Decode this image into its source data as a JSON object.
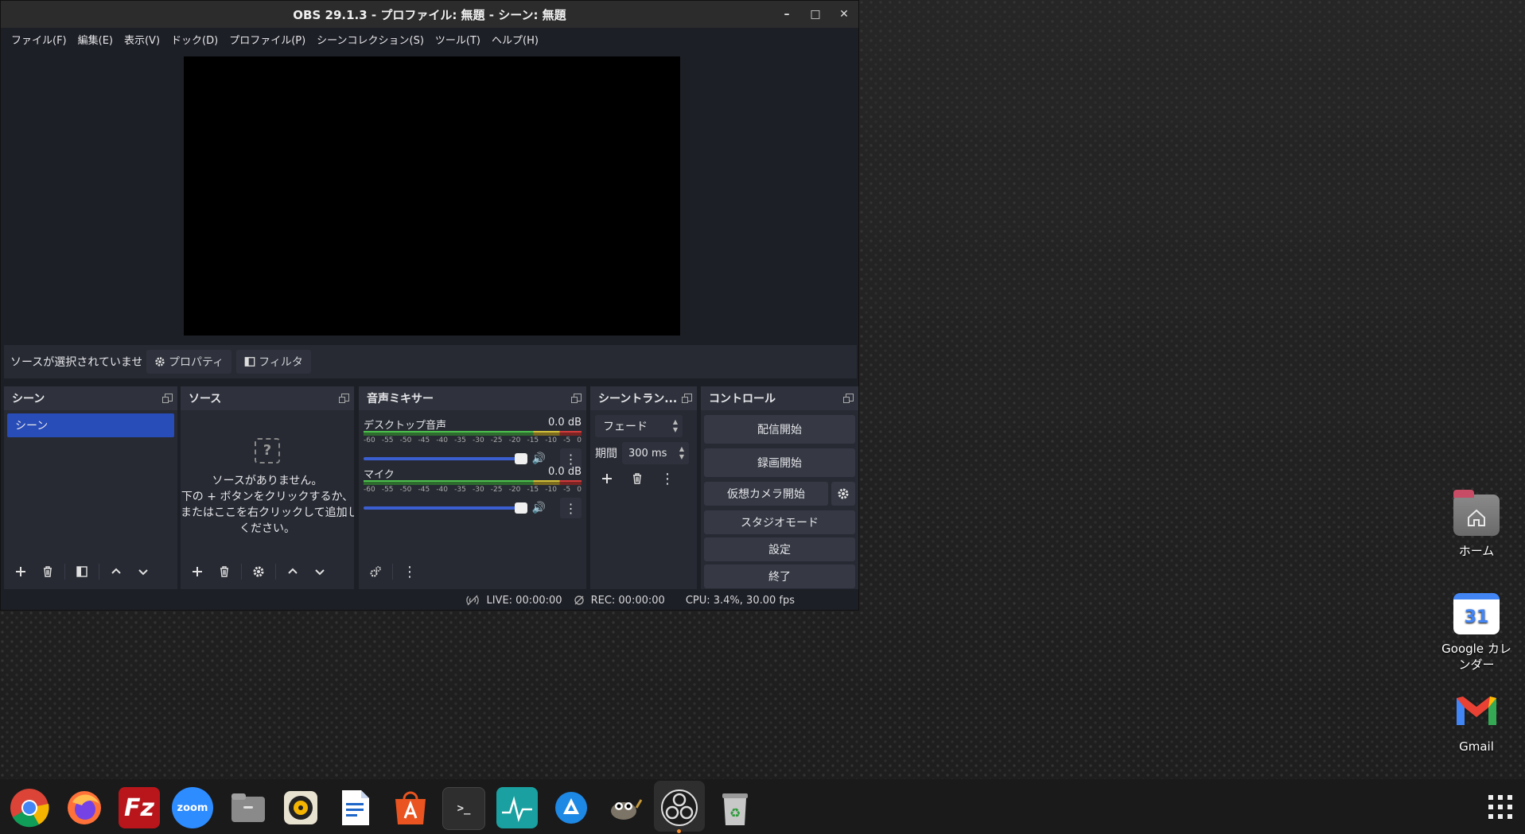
{
  "window": {
    "title": "OBS 29.1.3 - プロファイル: 無題 - シーン: 無題",
    "minimize_glyph": "–",
    "maximize_glyph": "□",
    "close_glyph": "✕"
  },
  "menu": [
    "ファイル(F)",
    "編集(E)",
    "表示(V)",
    "ドック(D)",
    "プロファイル(P)",
    "シーンコレクション(S)",
    "ツール(T)",
    "ヘルプ(H)"
  ],
  "source_toolbar": {
    "no_source": "ソースが選択されていません",
    "properties": "プロパティ",
    "filters": "フィルタ"
  },
  "docks": {
    "scenes": {
      "title": "シーン",
      "items": [
        "シーン"
      ]
    },
    "sources": {
      "title": "ソース",
      "empty_line1": "ソースがありません。",
      "empty_line2": "下の + ボタンをクリックするか、",
      "empty_line3": "またはここを右クリックして追加して",
      "empty_line4": "ください。"
    },
    "mixer": {
      "title": "音声ミキサー",
      "channels": [
        {
          "name": "デスクトップ音声",
          "db": "0.0 dB"
        },
        {
          "name": "マイク",
          "db": "0.0 dB"
        }
      ],
      "ticks": [
        "-60",
        "-55",
        "-50",
        "-45",
        "-40",
        "-35",
        "-30",
        "-25",
        "-20",
        "-15",
        "-10",
        "-5",
        "0"
      ]
    },
    "transitions": {
      "title": "シーントラン...",
      "selected": "フェード",
      "duration_label": "期間",
      "duration_value": "300 ms"
    },
    "controls": {
      "title": "コントロール",
      "start_streaming": "配信開始",
      "start_recording": "録画開始",
      "virtual_camera": "仮想カメラ開始",
      "studio_mode": "スタジオモード",
      "settings": "設定",
      "exit": "終了"
    }
  },
  "status": {
    "live": "LIVE: 00:00:00",
    "rec": "REC: 00:00:00",
    "cpu": "CPU: 3.4%, 30.00 fps"
  },
  "desktop_icons": {
    "home": "ホーム",
    "calendar": "Google カレンダー",
    "calendar_day": "31",
    "gmail": "Gmail"
  },
  "dock_apps": {
    "zoom": "zoom",
    "filezilla": "Fz",
    "terminal": ">_"
  },
  "colors": {
    "accent": "#284cb8",
    "panel": "#272a33",
    "window_bg": "#1d1f26"
  }
}
